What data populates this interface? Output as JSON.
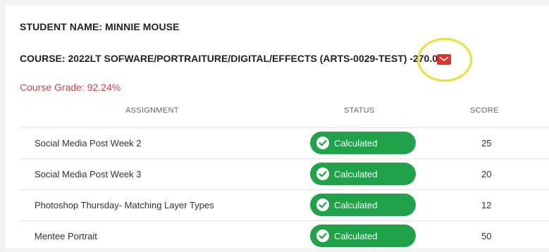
{
  "student": {
    "label": "STUDENT NAME: MINNIE MOUSE"
  },
  "course": {
    "label": "COURSE: 2022LT SOFWARE/PORTRAITURE/DIGITAL/EFFECTS (ARTS-0029-TEST) -270.00"
  },
  "course_grade": {
    "label": "Course Grade: 92.24%"
  },
  "table": {
    "headers": {
      "assignment": "ASSIGNMENT",
      "status": "STATUS",
      "score": "SCORE"
    },
    "rows": [
      {
        "assignment": "Social Media Post Week 2",
        "status": "Calculated",
        "score": "25"
      },
      {
        "assignment": "Social Media Post Week 3",
        "status": "Calculated",
        "score": "20"
      },
      {
        "assignment": "Photoshop Thursday- Matching Layer Types",
        "status": "Calculated",
        "score": "12"
      },
      {
        "assignment": "Mentee Portrait",
        "status": "Calculated",
        "score": "50"
      }
    ]
  },
  "icons": {
    "mail": "mail-icon",
    "status": "check-badge-icon"
  },
  "colors": {
    "grade_red": "#d64545",
    "status_green": "#1fa24a",
    "mail_red": "#e0322c",
    "highlight_yellow": "#e6e13c"
  }
}
